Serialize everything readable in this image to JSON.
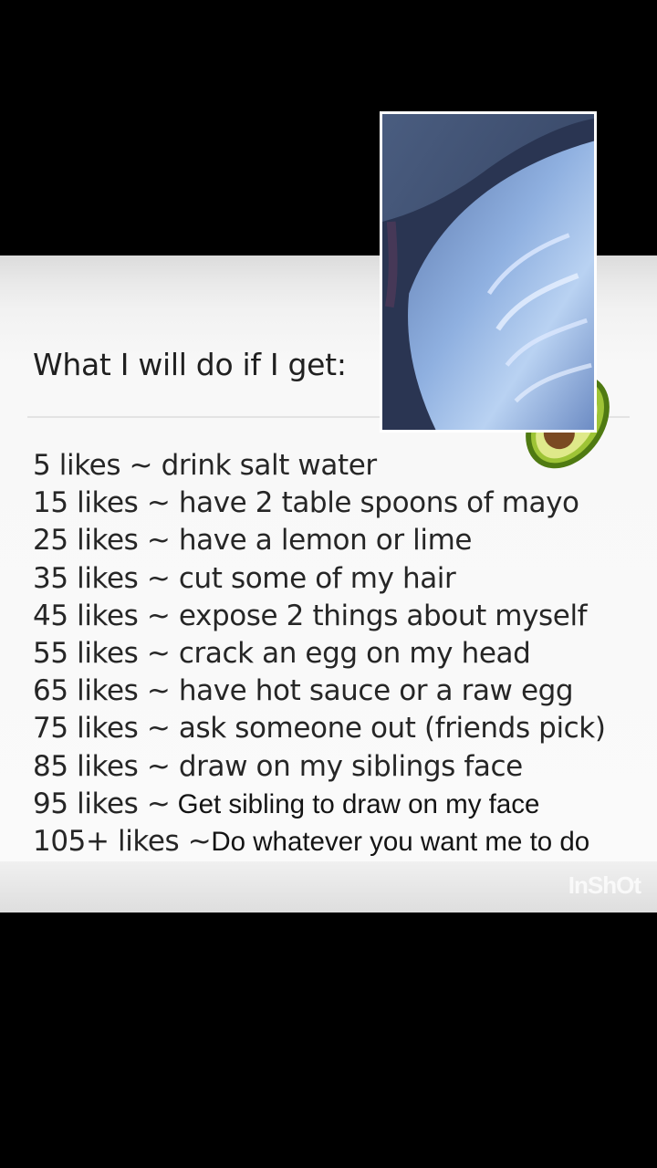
{
  "post": {
    "header": "What I will do if I get:",
    "rows": [
      {
        "likes": "5 likes ~",
        "action": " drink salt water"
      },
      {
        "likes": "15 likes ~",
        "action": " have 2 table spoons of mayo"
      },
      {
        "likes": "25 likes ~",
        "action": " have a lemon or lime"
      },
      {
        "likes": "35 likes ~",
        "action": " cut some of my hair"
      },
      {
        "likes": "45 likes ~",
        "action": " expose 2 things about myself"
      },
      {
        "likes": "55 likes ~",
        "action": " crack an egg on my head"
      },
      {
        "likes": "65 likes ~",
        "action": " have hot sauce or a raw egg"
      },
      {
        "likes": "75 likes ~",
        "action": " ask someone out (friends pick)"
      },
      {
        "likes": "85 likes ~",
        "action": " draw on my siblings face"
      },
      {
        "likes": "95 likes ~",
        "action": " Get sibling to draw on my face"
      },
      {
        "likes": "105+ likes ~",
        "action": "Do whatever you want me to do"
      }
    ]
  },
  "watermark": "InShOt",
  "icons": {
    "avocado": "avocado-emoji",
    "photo": "camera-overlay-photo"
  },
  "colors": {
    "background": "#000000",
    "card": "#f8f8f8",
    "text": "#262626"
  }
}
